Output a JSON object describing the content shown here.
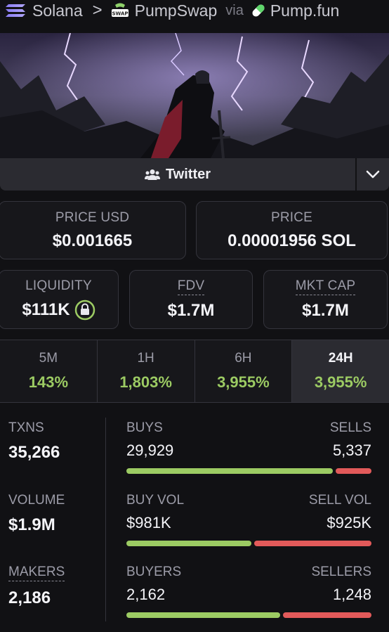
{
  "breadcrumb": {
    "chain": "Solana",
    "dex": "PumpSwap",
    "swap_badge": "SWAP",
    "via": "via",
    "source": "Pump.fun"
  },
  "social": {
    "twitter_label": "Twitter"
  },
  "prices": {
    "usd_label": "PRICE USD",
    "usd_value": "$0.001665",
    "native_label": "PRICE",
    "native_value": "0.00001956 SOL"
  },
  "metrics": {
    "liquidity_label": "LIQUIDITY",
    "liquidity_value": "$111K",
    "fdv_label": "FDV",
    "fdv_value": "$1.7M",
    "mktcap_label": "MKT CAP",
    "mktcap_value": "$1.7M"
  },
  "timeframes": [
    {
      "label": "5M",
      "change": "143%"
    },
    {
      "label": "1H",
      "change": "1,803%"
    },
    {
      "label": "6H",
      "change": "3,955%"
    },
    {
      "label": "24H",
      "change": "3,955%",
      "active": true
    }
  ],
  "stats": {
    "txns_label": "TXNS",
    "txns_value": "35,266",
    "volume_label": "VOLUME",
    "volume_value": "$1.9M",
    "makers_label": "MAKERS",
    "makers_value": "2,186",
    "buys_label": "BUYS",
    "buys_value": "29,929",
    "sells_label": "SELLS",
    "sells_value": "5,337",
    "buy_vol_label": "BUY VOL",
    "buy_vol_value": "$981K",
    "sell_vol_label": "SELL VOL",
    "sell_vol_value": "$925K",
    "buyers_label": "BUYERS",
    "buyers_value": "2,162",
    "sellers_label": "SELLERS",
    "sellers_value": "1,248",
    "buy_share": {
      "txns": 0.849,
      "volume": 0.515,
      "makers": 0.634
    }
  },
  "colors": {
    "positive": "#9ccb63",
    "negative": "#e25a5a",
    "background": "#111114",
    "panel": "#2b2b31"
  },
  "icons": {
    "chain": "solana-logo-icon",
    "dex": "pumpswap-logo-icon",
    "source": "pill-icon",
    "social": "users-icon",
    "expand": "chevron-down-icon",
    "liquidity_locked": "lock-icon"
  }
}
